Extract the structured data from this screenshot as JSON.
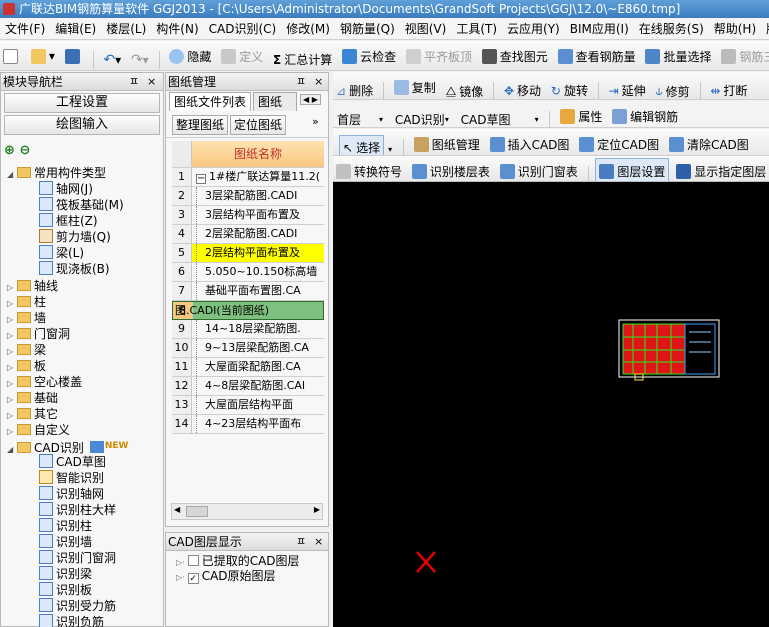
{
  "window": {
    "title": "广联达BIM钢筋算量软件 GGJ2013 - [C:\\Users\\Administrator\\Documents\\GrandSoft Projects\\GGJ\\12.0\\~E860.tmp]"
  },
  "menu": [
    "文件(F)",
    "编辑(E)",
    "楼层(L)",
    "构件(N)",
    "CAD识别(C)",
    "修改(M)",
    "钢筋量(Q)",
    "视图(V)",
    "工具(T)",
    "云应用(Y)",
    "BIM应用(I)",
    "在线服务(S)",
    "帮助(H)",
    "版本"
  ],
  "toolbar1": {
    "hide": "隐藏",
    "define": "定义",
    "summary": "汇总计算",
    "cloud_check": "云检查",
    "flat_top": "平齐板顶",
    "find": "查找图元",
    "view_rebar": "查看钢筋量",
    "batch": "批量选择",
    "rebar3d": "钢筋三"
  },
  "nav": {
    "title": "模块导航栏",
    "btn_project": "工程设置",
    "btn_draw": "绘图输入",
    "pin": "ꟼ",
    "close": "×"
  },
  "tree": {
    "common": "常用构件类型",
    "common_items": [
      "轴网(J)",
      "筏板基础(M)",
      "框柱(Z)",
      "剪力墙(Q)",
      "梁(L)",
      "现浇板(B)"
    ],
    "groups": [
      "轴线",
      "柱",
      "墙",
      "门窗洞",
      "梁",
      "板",
      "空心楼盖",
      "基础",
      "其它",
      "自定义"
    ],
    "cad": "CAD识别",
    "new_badge": "NEW",
    "cad_items": [
      "CAD草图",
      "智能识别",
      "识别轴网",
      "识别柱大样",
      "识别柱",
      "识别墙",
      "识别门窗洞",
      "识别梁",
      "识别板",
      "识别受力筋",
      "识别负筋"
    ]
  },
  "drawing_mgr": {
    "title": "图纸管理",
    "tab_list": "图纸文件列表",
    "tab_other": "图纸楼",
    "btn_organize": "整理图纸",
    "btn_locate": "定位图纸",
    "col_name": "图纸名称",
    "rows": [
      {
        "n": "1",
        "t": "1#楼广联达算量11.2(",
        "expand": "−"
      },
      {
        "n": "2",
        "t": "3层梁配筋图.CADI"
      },
      {
        "n": "3",
        "t": "3层结构平面布置及"
      },
      {
        "n": "4",
        "t": "2层梁配筋图.CADI"
      },
      {
        "n": "5",
        "t": "2层结构平面布置及",
        "hl": "yellow"
      },
      {
        "n": "6",
        "t": "5.050~10.150标高墙"
      },
      {
        "n": "7",
        "t": "基础平面布置图.CA"
      },
      {
        "n": "8",
        "t": "图.CADI(当前图纸)",
        "hl": "green"
      },
      {
        "n": "9",
        "t": "14~18层梁配筋图."
      },
      {
        "n": "10",
        "t": "9~13层梁配筋图.CA"
      },
      {
        "n": "11",
        "t": "大屋面梁配筋图.CA"
      },
      {
        "n": "12",
        "t": "4~8层梁配筋图.CAI"
      },
      {
        "n": "13",
        "t": "大屋面层结构平面"
      },
      {
        "n": "14",
        "t": "4~23层结构平面布"
      }
    ]
  },
  "layer_panel": {
    "title": "CAD图层显示",
    "items": [
      "已提取的CAD图层",
      "CAD原始图层"
    ]
  },
  "toolbar2": {
    "delete": "删除",
    "copy": "复制",
    "mirror": "镜像",
    "move": "移动",
    "rotate": "旋转",
    "extend": "延伸",
    "trim": "修剪",
    "break": "打断"
  },
  "toolbar3": {
    "floor": "首层",
    "cad_recog": "CAD识别",
    "cad_sketch": "CAD草图",
    "attr": "属性",
    "edit_rebar": "编辑钢筋"
  },
  "toolbar4": {
    "select": "选择",
    "dwg_mgr": "图纸管理",
    "insert_cad": "插入CAD图",
    "locate_cad": "定位CAD图",
    "clear_cad": "清除CAD图"
  },
  "toolbar5": {
    "convert": "转换符号",
    "floor_table": "识别楼层表",
    "door_table": "识别门窗表",
    "layer_set": "图层设置",
    "show_layer": "显示指定图层"
  },
  "colors": {
    "accent": "#3b7cc0",
    "highlight_yellow": "#ffff00",
    "highlight_green": "#7ec07e",
    "canvas": "#000000",
    "drawing_red": "#e01515",
    "drawing_green": "#22ee22",
    "marker": "#e00000"
  }
}
